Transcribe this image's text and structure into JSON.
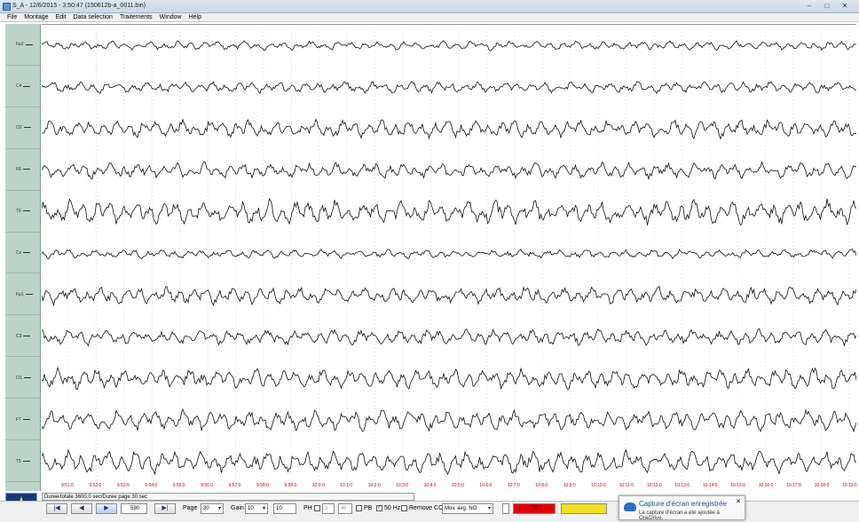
{
  "window": {
    "title": "S_A - 12/6/2015 - 3:50:47 (150612b-a_0011.bin)",
    "buttons": [
      "–",
      "□",
      "✕"
    ]
  },
  "menu": [
    "File",
    "Montage",
    "Edit",
    "Data selection",
    "Traitements",
    "Window",
    "Help"
  ],
  "channels": [
    "Fp2",
    "C4",
    "O2",
    "F8",
    "T6",
    "Cz",
    "Fp1",
    "C3",
    "O1",
    "F7",
    "T5"
  ],
  "time_labels": [
    "9:51:0",
    "9:52:0",
    "9:53:0",
    "9:54:0",
    "9:55:0",
    "9:56:0",
    "9:57:0",
    "9:58:0",
    "9:59:0",
    "10:0:0",
    "10:1:0",
    "10:2:0",
    "10:3:0",
    "10:4:0",
    "10:5:0",
    "10:6:0",
    "10:7:0",
    "10:8:0",
    "10:9:0",
    "10:10:0",
    "10:11:0",
    "10:12:0",
    "10:13:0",
    "10:14:0",
    "10:15:0",
    "10:16:0",
    "10:17:0",
    "10:18:0",
    "10:19:0"
  ],
  "status": {
    "duree": "Duree totale 3600.0 sec/Duree page 30 sec"
  },
  "controls": {
    "first": "|◀",
    "prev": "◀",
    "next": "▶",
    "last": "▶|",
    "position": "590",
    "page_label": "Page",
    "page_value": "30",
    "gain_label": "Gain",
    "gain_value": "10",
    "gain_extra": "10",
    "ph_label": "PH",
    "ph_value": "3",
    "pb_value": "45",
    "pb_label": "PB",
    "hz_label": "50 Hz",
    "hz_checked": "✓",
    "remove_label": "Remove CC",
    "movavg": "Mov. avg. NO",
    "red_value": "20"
  },
  "toast": {
    "title": "Capture d'écran enregistrée",
    "body": "La capture d'écran a été ajoutée à OneDrive.",
    "close": "✕"
  },
  "colors": {
    "labels_bg": "#bcd4c8",
    "time_red": "#c00000",
    "status_red": "#e00000",
    "status_yellow": "#f0e020"
  }
}
